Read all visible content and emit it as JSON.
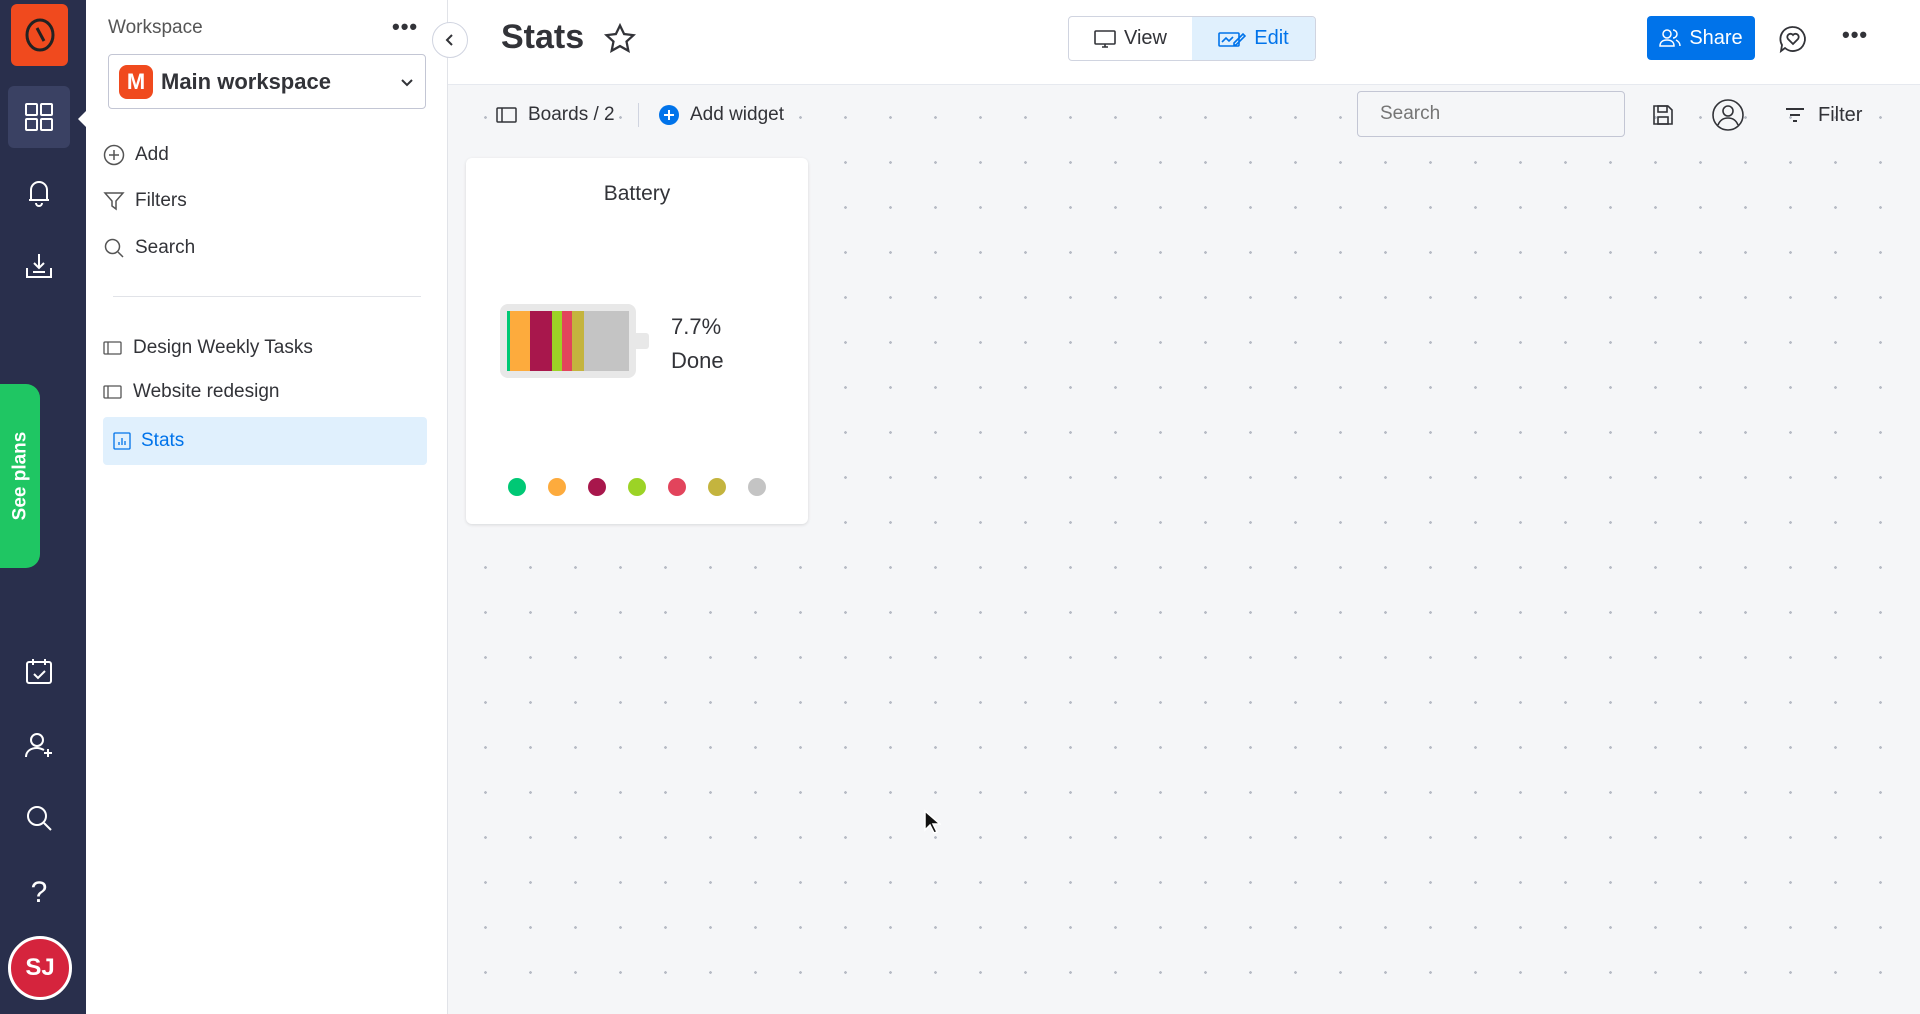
{
  "rail": {
    "items": [
      "workspaces-icon",
      "notifications-icon",
      "inbox-icon",
      "my-work-icon",
      "invite-icon",
      "search-icon",
      "help-icon"
    ],
    "plans_label": "See plans",
    "avatar_initials": "SJ",
    "colors": {
      "bg": "#292f4c",
      "logo": "#f04a1e",
      "plans": "#1fc663",
      "avatar": "#d5243d"
    }
  },
  "sidebar": {
    "title": "Workspace",
    "workspace": {
      "name": "Main workspace",
      "badge": "M"
    },
    "actions": [
      {
        "label": "Add",
        "icon": "plus-circle-icon"
      },
      {
        "label": "Filters",
        "icon": "filter-icon"
      },
      {
        "label": "Search",
        "icon": "search-icon"
      }
    ],
    "boards": [
      {
        "label": "Design Weekly Tasks",
        "icon": "board-icon",
        "selected": false
      },
      {
        "label": "Website redesign",
        "icon": "board-icon",
        "selected": false
      },
      {
        "label": "Stats",
        "icon": "dashboard-icon",
        "selected": true
      }
    ]
  },
  "header": {
    "title": "Stats",
    "view_label": "View",
    "edit_label": "Edit",
    "active_mode": "Edit",
    "share_label": "Share"
  },
  "toolbar": {
    "boards_label": "Boards / 2",
    "add_widget_label": "Add widget",
    "search_placeholder": "Search",
    "filter_label": "Filter"
  },
  "widget": {
    "title": "Battery",
    "percent": "7.7%",
    "status": "Done",
    "segments": [
      {
        "color": "#00c875",
        "share": 2.2
      },
      {
        "color": "#fdab3d",
        "share": 16.7
      },
      {
        "color": "#a8174c",
        "share": 17.8
      },
      {
        "color": "#9cd326",
        "share": 8.3
      },
      {
        "color": "#e2445c",
        "share": 8.6
      },
      {
        "color": "#c4b43e",
        "share": 9.4
      },
      {
        "color": "#c4c4c4",
        "share": 36.9
      }
    ]
  },
  "accent": "#0073ea"
}
